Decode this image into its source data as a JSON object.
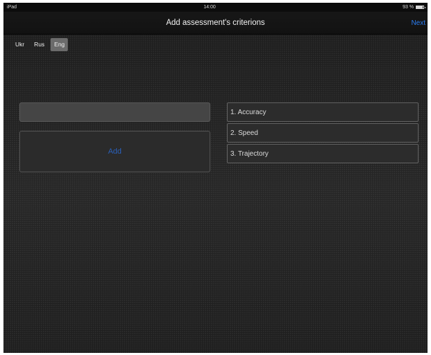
{
  "status_bar": {
    "device": "iPad",
    "time": "14:00",
    "battery": "93 %"
  },
  "nav": {
    "title": "Add assessment's criterions",
    "next_label": "Next"
  },
  "languages": [
    {
      "label": "Ukr",
      "selected": false
    },
    {
      "label": "Rus",
      "selected": false
    },
    {
      "label": "Eng",
      "selected": true
    }
  ],
  "form": {
    "input_value": "",
    "add_label": "Add"
  },
  "criteria": [
    {
      "label": "1. Accuracy"
    },
    {
      "label": "2. Speed"
    },
    {
      "label": "3. Trajectory"
    }
  ],
  "colors": {
    "accent": "#2b7cf0",
    "add_text": "#2a5fb8",
    "background": "#202020"
  },
  "icons": [
    "battery-icon"
  ]
}
